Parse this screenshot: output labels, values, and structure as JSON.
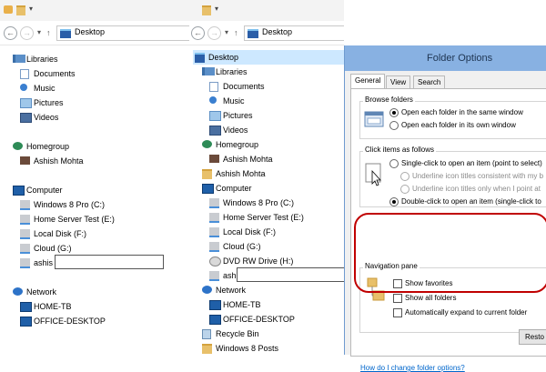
{
  "address": {
    "location": "Desktop"
  },
  "left_tree": {
    "items": [
      {
        "label": "Libraries",
        "icon": "libraries-icon"
      },
      {
        "label": "Documents",
        "icon": "documents-icon"
      },
      {
        "label": "Music",
        "icon": "music-icon"
      },
      {
        "label": "Pictures",
        "icon": "pictures-icon"
      },
      {
        "label": "Videos",
        "icon": "videos-icon"
      },
      {
        "label": "Homegroup",
        "icon": "homegroup-icon"
      },
      {
        "label": "Ashish Mohta",
        "icon": "user-icon"
      },
      {
        "label": "Computer",
        "icon": "computer-icon"
      },
      {
        "label": "Windows 8 Pro (C:)",
        "icon": "drive-icon"
      },
      {
        "label": "Home Server Test (E:)",
        "icon": "drive-icon"
      },
      {
        "label": "Local Disk (F:)",
        "icon": "drive-icon"
      },
      {
        "label": "Cloud (G:)",
        "icon": "drive-icon"
      },
      {
        "label": "ashis",
        "icon": "drive-icon"
      },
      {
        "label": "Network",
        "icon": "network-icon"
      },
      {
        "label": "HOME-TB",
        "icon": "pc-icon"
      },
      {
        "label": "OFFICE-DESKTOP",
        "icon": "pc-icon"
      }
    ]
  },
  "mid_tree": {
    "items": [
      {
        "label": "Desktop",
        "icon": "desktop-icon"
      },
      {
        "label": "Libraries",
        "icon": "libraries-icon"
      },
      {
        "label": "Documents",
        "icon": "documents-icon"
      },
      {
        "label": "Music",
        "icon": "music-icon"
      },
      {
        "label": "Pictures",
        "icon": "pictures-icon"
      },
      {
        "label": "Videos",
        "icon": "videos-icon"
      },
      {
        "label": "Homegroup",
        "icon": "homegroup-icon"
      },
      {
        "label": "Ashish Mohta",
        "icon": "user-icon"
      },
      {
        "label": "Ashish Mohta",
        "icon": "user-folder-icon"
      },
      {
        "label": "Computer",
        "icon": "computer-icon"
      },
      {
        "label": "Windows 8 Pro (C:)",
        "icon": "drive-icon"
      },
      {
        "label": "Home Server Test (E:)",
        "icon": "drive-icon"
      },
      {
        "label": "Local Disk (F:)",
        "icon": "drive-icon"
      },
      {
        "label": "Cloud (G:)",
        "icon": "drive-icon"
      },
      {
        "label": "DVD RW Drive (H:)",
        "icon": "dvd-icon"
      },
      {
        "label": "ashis",
        "icon": "drive-icon"
      },
      {
        "label": "Network",
        "icon": "network-icon"
      },
      {
        "label": "HOME-TB",
        "icon": "pc-icon"
      },
      {
        "label": "OFFICE-DESKTOP",
        "icon": "pc-icon"
      },
      {
        "label": "Recycle Bin",
        "icon": "recycle-bin-icon"
      },
      {
        "label": "Windows 8 Posts",
        "icon": "folder-icon"
      }
    ]
  },
  "dialog": {
    "title": "Folder Options",
    "tabs": [
      "General",
      "View",
      "Search"
    ],
    "browse": {
      "label": "Browse folders",
      "opt1": "Open each folder in the same window",
      "opt2": "Open each folder in its own window"
    },
    "click": {
      "label": "Click items as follows",
      "opt1": "Single-click to open an item (point to select)",
      "sub1": "Underline icon titles consistent with my b",
      "sub2": "Underline icon titles only when I point at",
      "opt2": "Double-click to open an item (single-click to"
    },
    "nav": {
      "label": "Navigation pane",
      "cb1": "Show favorites",
      "cb2": "Show all folders",
      "cb3": "Automatically expand to current folder"
    },
    "restore_label": "Resto",
    "help_link": "How do I change folder options?"
  },
  "colors": {
    "accent": "#88b1e2",
    "annotation": "#c00000",
    "selection": "#cde8ff"
  }
}
